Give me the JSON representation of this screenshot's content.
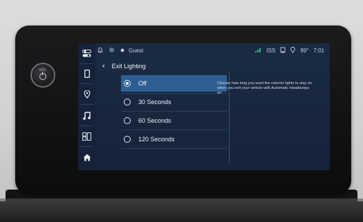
{
  "status_bar": {
    "user": "Guest",
    "connectivity": "ISS",
    "temperature": "99°",
    "time": "7:01"
  },
  "header": {
    "title": "Exit Lighting"
  },
  "options": [
    {
      "label": "Off",
      "selected": true
    },
    {
      "label": "30 Seconds",
      "selected": false
    },
    {
      "label": "60 Seconds",
      "selected": false
    },
    {
      "label": "120 Seconds",
      "selected": false
    }
  ],
  "description": "Choose how long you want the exterior lights to stay on when you exit your vehicle with Automatic Headlamps on.",
  "knob": {
    "label": "VOL"
  },
  "rail_icons": [
    "toggle-icon",
    "phone-icon",
    "location-pin-icon",
    "music-note-icon",
    "apps-grid-icon",
    "home-icon"
  ],
  "colors": {
    "selected_row": "#2e5e93",
    "screen_bg": "#15233a"
  }
}
